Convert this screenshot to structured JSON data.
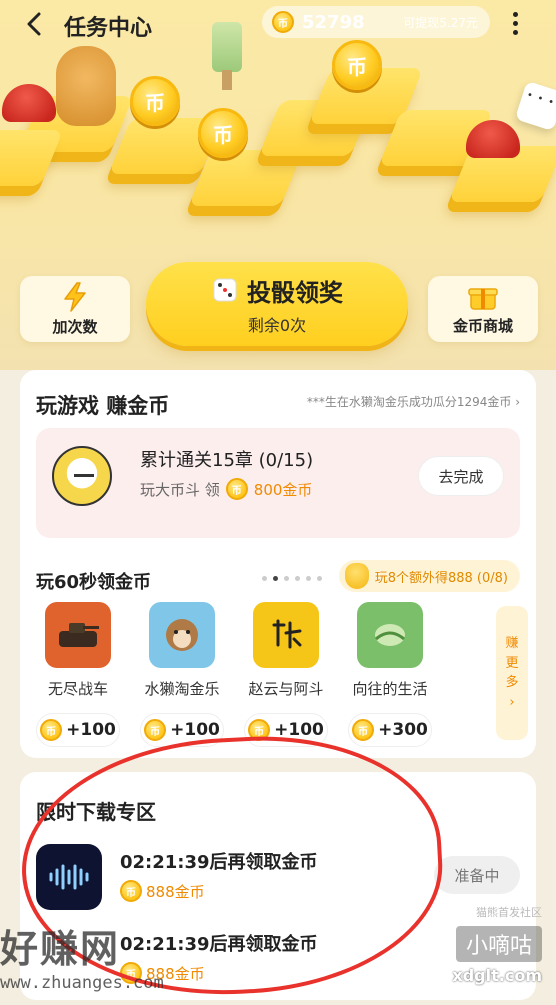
{
  "header": {
    "title": "任务中心",
    "coin_count": "52798",
    "cash_text": "可提现5.27元"
  },
  "board": {
    "coin_glyph": "币"
  },
  "actions": {
    "left_label": "加次数",
    "main_label": "投骰领奖",
    "main_sub": "剩余0次",
    "right_label": "金币商城"
  },
  "play_section": {
    "title": "玩游戏 赚金币",
    "marquee": "***生在水獭淘金乐成功瓜分1294金币 ›",
    "task": {
      "title": "累计通关15章 (0/15)",
      "sub_prefix": "玩大币斗 领",
      "reward": "800金币",
      "button": "去完成"
    },
    "sub_title": "玩60秒领金币",
    "bonus": "玩8个额外得888 (0/8)",
    "games": [
      {
        "name": "无尽战车",
        "reward": "+100",
        "color": "#e0622c"
      },
      {
        "name": "水獭淘金乐",
        "reward": "+100",
        "color": "#7fc6e8"
      },
      {
        "name": "赵云与阿斗",
        "reward": "+100",
        "color": "#f5c518"
      },
      {
        "name": "向往的生活",
        "reward": "+300",
        "color": "#7bbf6a"
      }
    ],
    "more_label": [
      "赚",
      "更",
      "多",
      "›"
    ]
  },
  "download_section": {
    "title": "限时下载专区",
    "rows": [
      {
        "title": "02:21:39后再领取金币",
        "reward": "888金币",
        "button": "准备中"
      },
      {
        "title": "02:21:39后再领取金币",
        "reward": "888金币"
      }
    ]
  },
  "watermarks": {
    "left_big": "好赚网",
    "left_url": "www.zhuanges.com",
    "right_top": "猫熊首发社区",
    "right_box": "小嘀咕",
    "right_url": "xdglt.com"
  }
}
